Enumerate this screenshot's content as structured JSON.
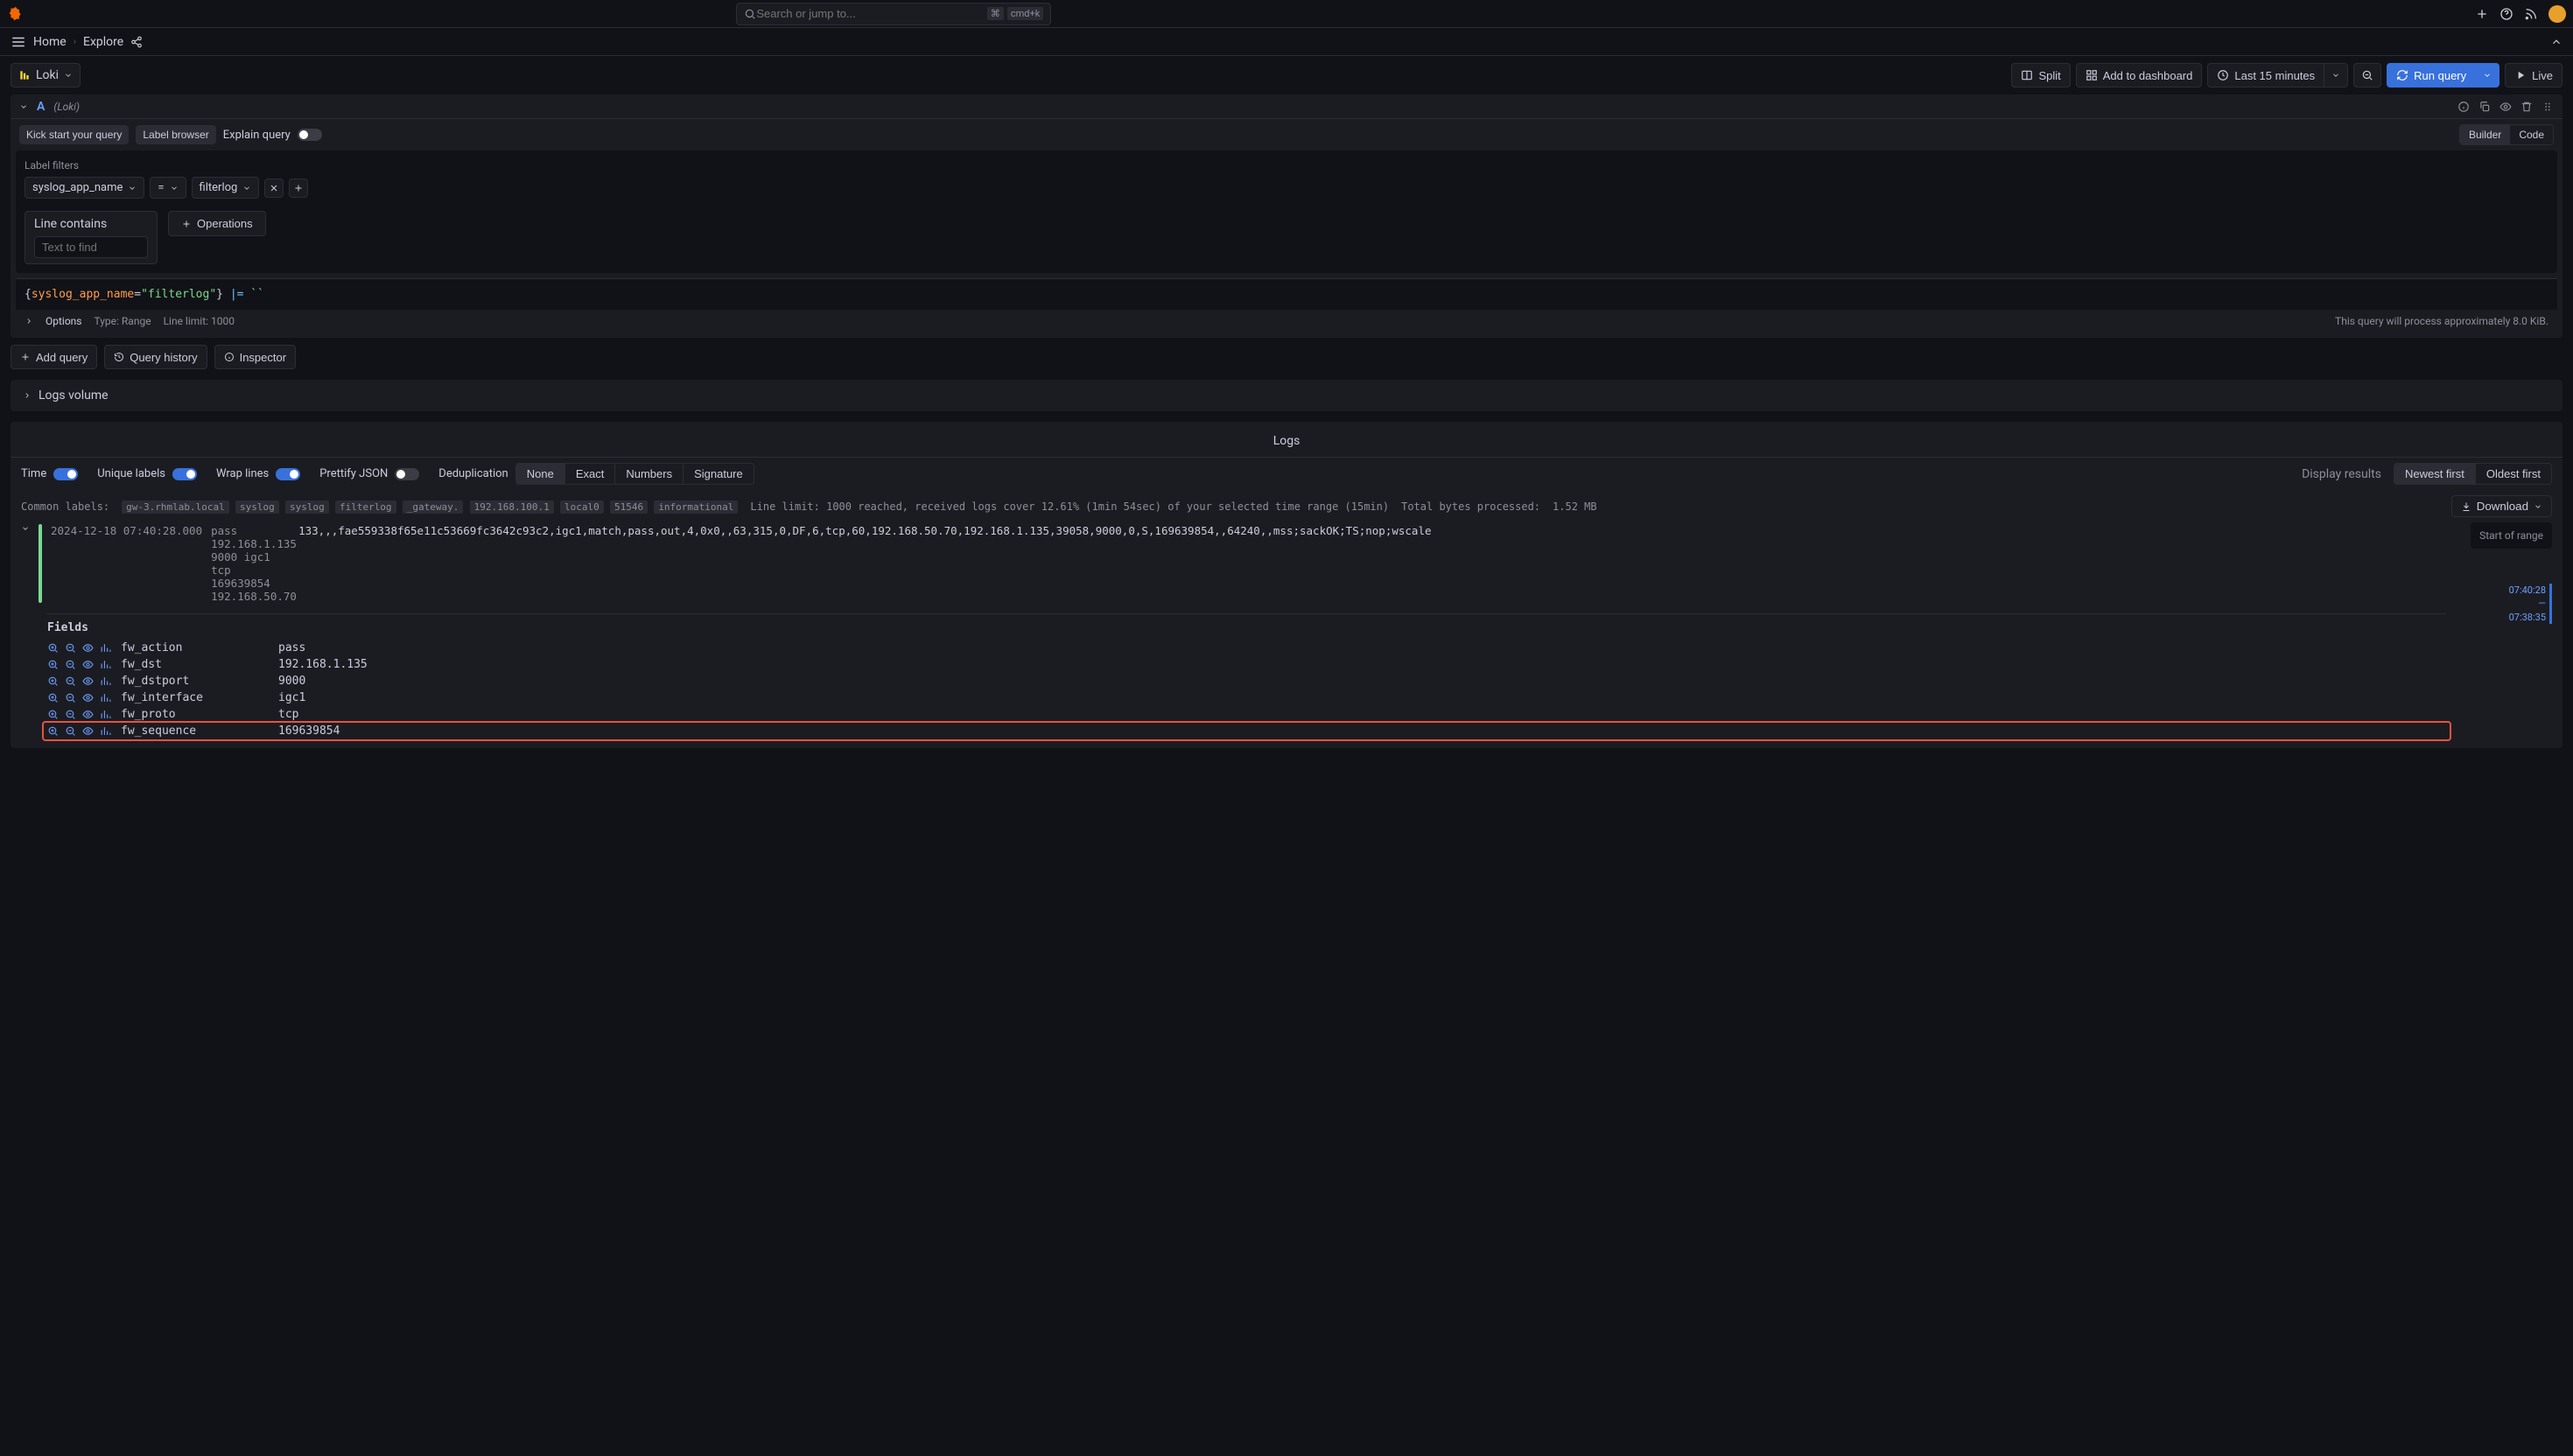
{
  "top": {
    "search_placeholder": "Search or jump to...",
    "shortcut": "cmd+k"
  },
  "nav": {
    "home": "Home",
    "explore": "Explore"
  },
  "datasource": {
    "name": "Loki"
  },
  "toolbar": {
    "split": "Split",
    "add_dash": "Add to dashboard",
    "time_range": "Last 15 minutes",
    "run": "Run query",
    "live": "Live"
  },
  "query": {
    "letter": "A",
    "ds_hint": "(Loki)",
    "kick_start": "Kick start your query",
    "label_browser": "Label browser",
    "explain": "Explain query",
    "mode_builder": "Builder",
    "mode_code": "Code",
    "label_filters_title": "Label filters",
    "filter_key": "syslog_app_name",
    "filter_op": "=",
    "filter_val": "filterlog",
    "line_contains": "Line contains",
    "text_to_find_ph": "Text to find",
    "operations": "Operations",
    "code_key": "syslog_app_name",
    "code_val": "\"filterlog\"",
    "code_pipe": "|=",
    "code_empty": "``",
    "opt_label": "Options",
    "opt_type": "Type: Range",
    "opt_limit": "Line limit: 1000",
    "hint": "This query will process approximately 8.0 KiB."
  },
  "actions": {
    "add_query": "Add query",
    "history": "Query history",
    "inspector": "Inspector"
  },
  "logs_volume": "Logs volume",
  "logs": {
    "title": "Logs",
    "time_lbl": "Time",
    "unique_lbl": "Unique labels",
    "wrap_lbl": "Wrap lines",
    "pretty_lbl": "Prettify JSON",
    "dedup_lbl": "Deduplication",
    "dedup_opts": [
      "None",
      "Exact",
      "Numbers",
      "Signature"
    ],
    "display_results": "Display results",
    "newest": "Newest first",
    "oldest": "Oldest first",
    "common_labels": "Common labels:",
    "common_tags": [
      "gw-3.rhmlab.local",
      "syslog",
      "syslog",
      "filterlog",
      "_gateway.",
      "192.168.100.1",
      "local0",
      "51546",
      "informational"
    ],
    "line_limit_msg": "Line limit: 1000 reached, received logs cover 12.61% (1min 54sec) of your selected time range (15min)",
    "bytes_lbl": "Total bytes processed:",
    "bytes_val": "1.52 MB",
    "download": "Download",
    "entry_ts": "2024-12-18 07:40:28.000",
    "entry_side": [
      "pass",
      "192.168.1.135",
      "9000 igc1 tcp",
      "169639854",
      "192.168.50.70"
    ],
    "entry_msg": "133,,,fae559338f65e11c53669fc3642c93c2,igc1,match,pass,out,4,0x0,,63,315,0,DF,6,tcp,60,192.168.50.70,192.168.1.135,39058,9000,0,S,169639854,,64240,,mss;sackOK;TS;nop;wscale",
    "range_start": "Start of range",
    "tick1": "07:40:28",
    "tick_sep": "—",
    "tick2": "07:38:35",
    "fields_title": "Fields",
    "fields": [
      {
        "k": "fw_action",
        "v": "pass"
      },
      {
        "k": "fw_dst",
        "v": "192.168.1.135"
      },
      {
        "k": "fw_dstport",
        "v": "9000"
      },
      {
        "k": "fw_interface",
        "v": "igc1"
      },
      {
        "k": "fw_proto",
        "v": "tcp"
      },
      {
        "k": "fw_sequence",
        "v": "169639854"
      }
    ]
  }
}
